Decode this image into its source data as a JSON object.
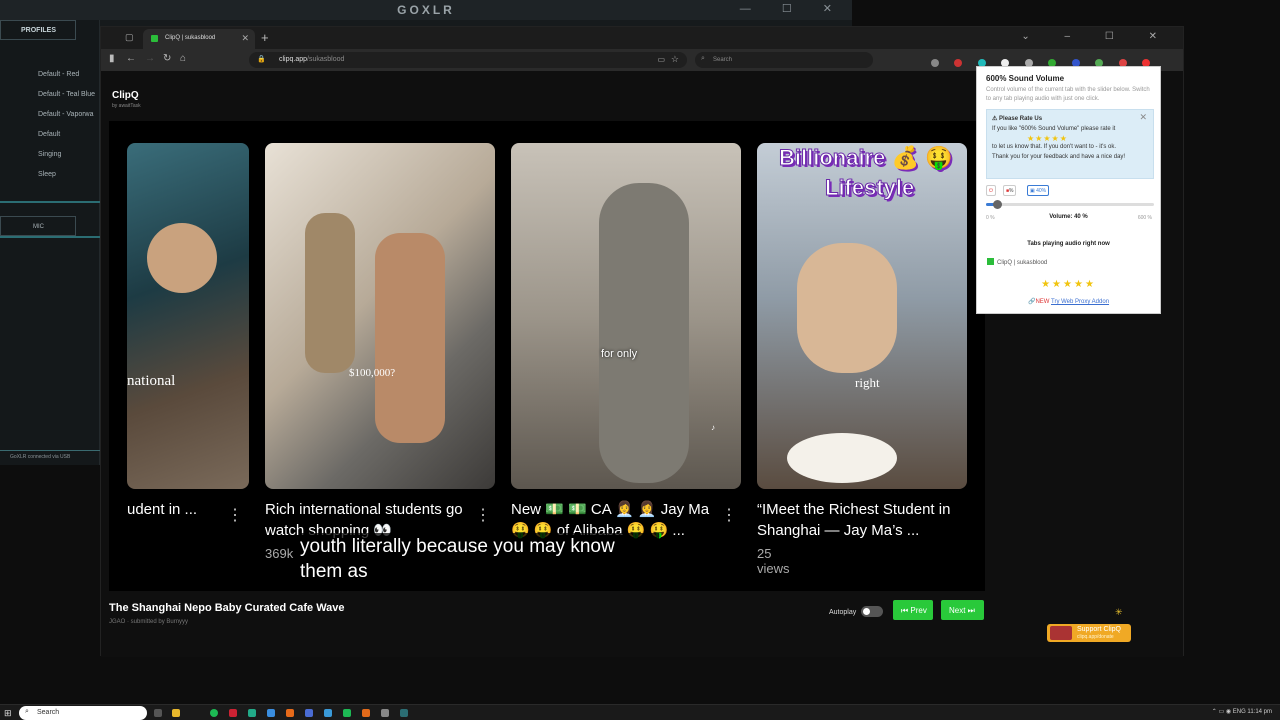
{
  "goxlr": {
    "title": "GOXLR",
    "profiles_tab": "PROFILES",
    "profiles": [
      "Default - Red",
      "Default - Teal Blue",
      "Default - Vaporwa",
      "Default",
      "Singing",
      "Sleep"
    ],
    "mic_tab": "MIC",
    "status": "GoXLR connected via USB"
  },
  "browser": {
    "tab_title": "ClipQ | sukasblood",
    "url_domain": "clipq.app",
    "url_path": "/sukasblood",
    "search_placeholder": "Search"
  },
  "page": {
    "brand": "ClipQ",
    "brand_sub": "by awaitTask",
    "cards": [
      {
        "title": "udent in ...",
        "views": "",
        "overlay_text": "national"
      },
      {
        "title": "Rich international students go watch shopping 👀",
        "views": "369k",
        "overlay_text": "$100,000?"
      },
      {
        "title": "New 💵 💵 CA 👩‍💼 👩‍💼 Jay Ma 🤑 🤑 of Alibaba 🤑 🤑 ...",
        "views": "",
        "overlay_text": "for only"
      },
      {
        "title": "“IMeet the Richest Student in Shanghai — Jay Ma’s ...",
        "views": "25 views",
        "overlay_text": "right",
        "banner_line1": "Billionaire 💰 🤑",
        "banner_line2": "Lifestyle"
      }
    ],
    "caption": "youth literally because you may know them as",
    "video_title": "The Shanghai Nepo Baby Curated Cafe Wave",
    "video_channel": "JGAO",
    "video_submitted": "· submitted by",
    "video_submitter": "Burnyyy",
    "autoplay_label": "Autoplay",
    "prev_label": "⏮ Prev",
    "next_label": "Next ⏭",
    "support_label": "Support ClipQ",
    "support_sub": "clipq.app/donate"
  },
  "popup": {
    "title": "600% Sound Volume",
    "desc": "Control volume of the current tab with the slider below. Switch to any tab playing audio with just one click.",
    "rate_title": "Please Rate Us",
    "rate_text1": "If you like \"600% Sound Volume\" please rate it",
    "rate_text2": "to let us know that. If you don't want to - it's ok.",
    "rate_text3": "Thank you for your feedback and have a nice day!",
    "btn_mute": "%",
    "btn_current": "40%",
    "volume_value": 40,
    "volume_max_pct": 600,
    "vol_min_label": "0 %",
    "vol_max_label": "600 %",
    "vol_label": "Volume: 40 %",
    "tabs_heading": "Tabs playing audio right now",
    "tab_entry": "ClipQ | sukasblood",
    "stars": "★★★★★",
    "proxy_new": "NEW",
    "proxy_link": "Try Web Proxy Addon"
  },
  "taskbar": {
    "search": "Search",
    "lang": "ENG",
    "time": "11:14 pm"
  },
  "colors": {
    "accent_green": "#29c93a",
    "support_orange": "#f0a925",
    "goxlr_teal": "#2b6d73"
  }
}
